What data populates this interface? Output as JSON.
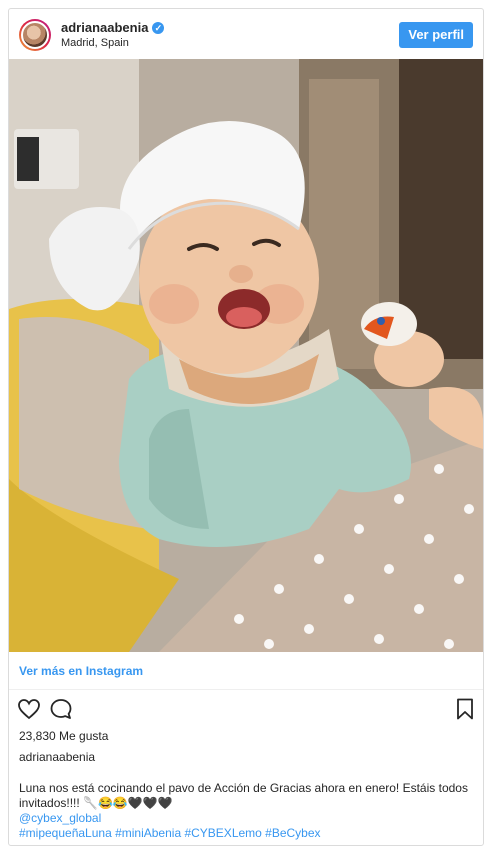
{
  "post": {
    "username": "adrianaabenia",
    "location": "Madrid, Spain",
    "view_profile_label": "Ver perfil",
    "view_more_label": "Ver más en Instagram",
    "likes_text": "23,830 Me gusta",
    "caption_author": "adrianaabenia",
    "caption_text": "Luna nos está cocinando el pavo de Acción de Gracias ahora en enero! Estáis todos invitados!!!! 🥄😂😂🖤🖤🖤",
    "mention": "@cybex_global",
    "hashtags": "#mipequeñaLuna #miniAbenia #CYBEXLemo #BeCybex"
  },
  "colors": {
    "accent": "#3897f0",
    "text": "#262626",
    "border": "#dbdbdb"
  },
  "icons": [
    "verified-icon",
    "heart-icon",
    "comment-icon",
    "bookmark-icon"
  ]
}
